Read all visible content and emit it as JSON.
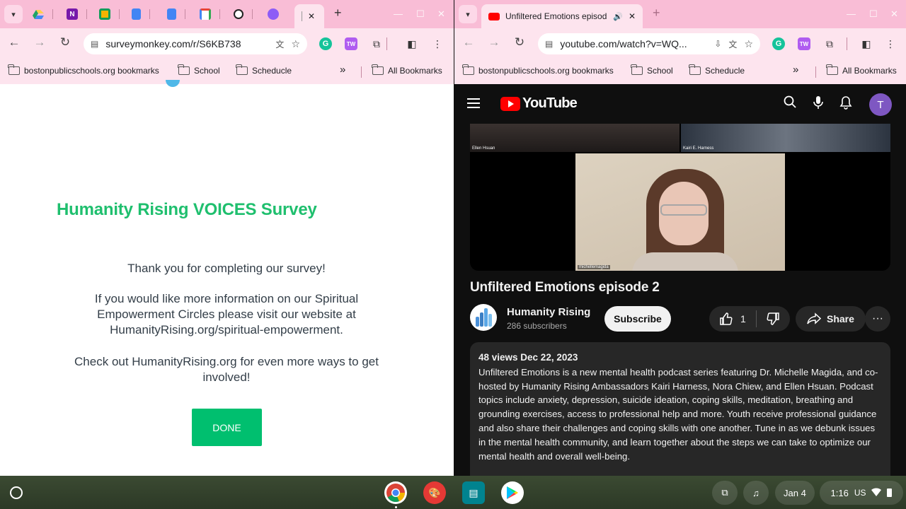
{
  "left_window": {
    "active_tab_close": "✕",
    "new_tab": "+",
    "url": "surveymonkey.com/r/S6KB738",
    "bookmarks": [
      "bostonpublicschools.org bookmarks",
      "School",
      "Scheducle"
    ],
    "bookmarks_overflow": "»",
    "all_bookmarks": "All Bookmarks"
  },
  "right_window": {
    "tab_title": "Unfiltered Emotions episod",
    "tab_audio": "🔊",
    "tab_close": "✕",
    "new_tab": "+",
    "url": "youtube.com/watch?v=WQ...",
    "bookmarks": [
      "bostonpublicschools.org bookmarks",
      "School",
      "Scheducle"
    ],
    "bookmarks_overflow": "»",
    "all_bookmarks": "All Bookmarks"
  },
  "survey": {
    "title": "Humanity Rising VOICES Survey",
    "thanks": "Thank you for completing our survey!",
    "info": "If you would like more information on our Spiritual Empowerment Circles please visit our website at HumanityRising.org/spiritual-empowerment.",
    "more": "Check out HumanityRising.org for even more ways to get involved!",
    "done_label": "DONE",
    "accent_color": "#00bf6f"
  },
  "youtube": {
    "wordmark": "YouTube",
    "avatar_letter": "T",
    "video": {
      "tile_labels": [
        "Ellen Hsuan",
        "Kairi E. Harness",
        "michellemagida"
      ]
    },
    "title": "Unfiltered Emotions episode 2",
    "channel": {
      "name": "Humanity Rising",
      "subscribers": "286 subscribers"
    },
    "subscribe_label": "Subscribe",
    "likes": "1",
    "share_label": "Share",
    "more_label": "···",
    "description": {
      "meta": "48 views  Dec 22, 2023",
      "text": "Unfiltered Emotions is a new mental health podcast series featuring Dr. Michelle Magida, and co-hosted by Humanity Rising Ambassadors Kairi Harness, Nora Chiew, and Ellen Hsuan. Podcast topics include anxiety, depression, suicide ideation, coping skills, meditation, breathing and grounding exercises, access to professional help and more. Youth receive professional guidance and also share their challenges and coping skills with one another. Tune in as we debunk issues in the mental health community, and learn together about the steps we can take to optimize our mental health and overall well-being."
    }
  },
  "shelf": {
    "date": "Jan 4",
    "time": "1:16",
    "locale": "US"
  }
}
